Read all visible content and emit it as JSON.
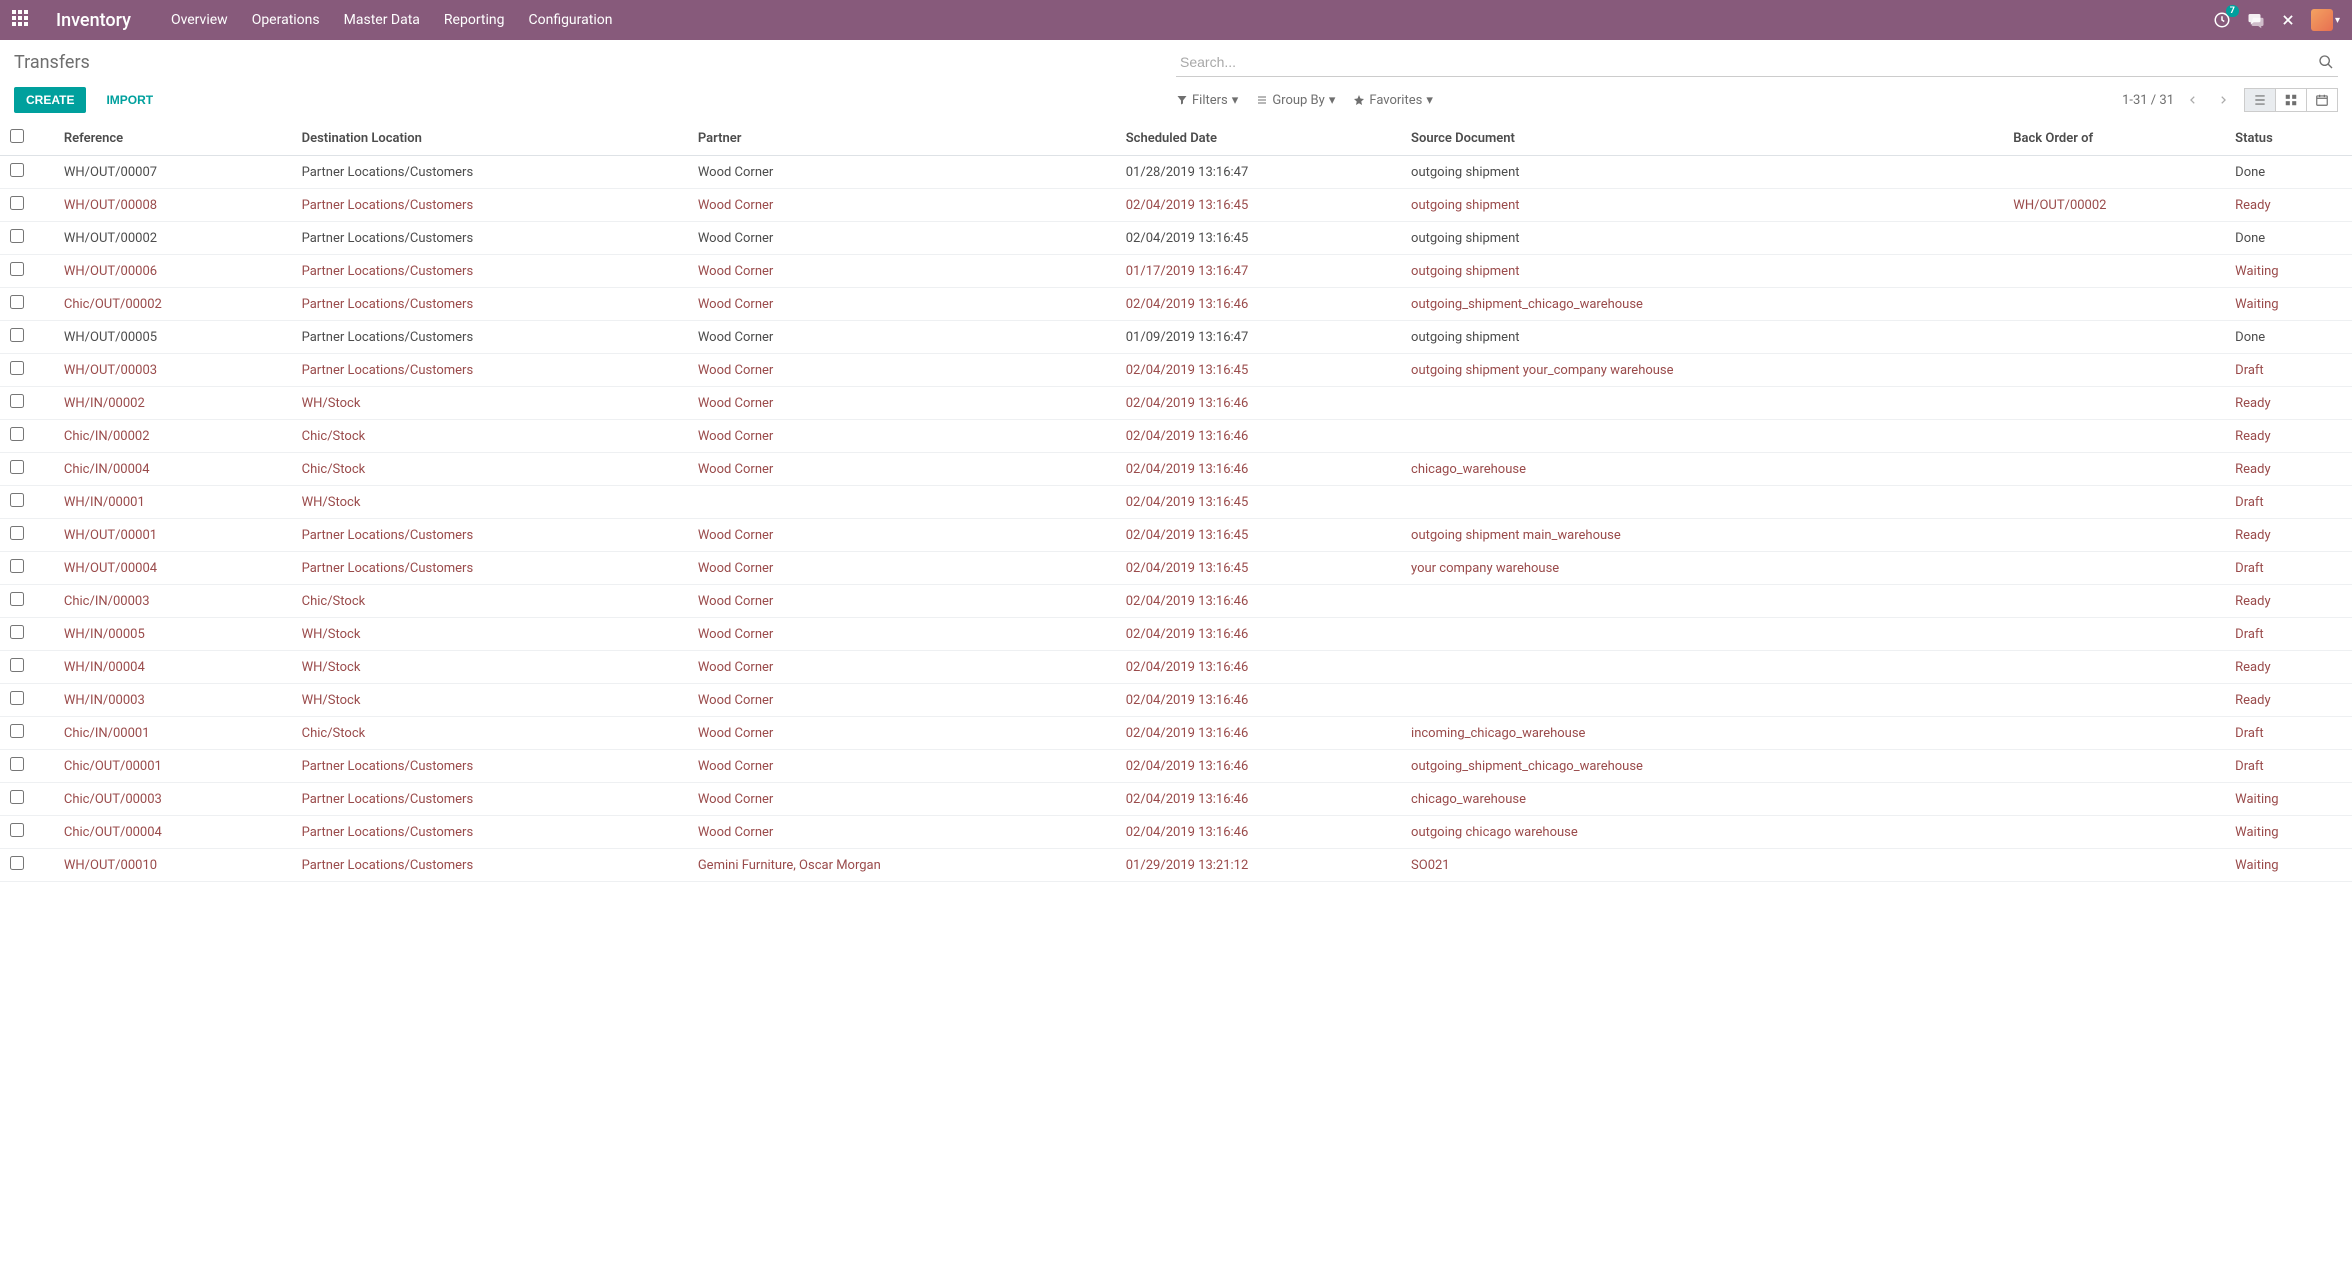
{
  "navbar": {
    "app_title": "Inventory",
    "menu": [
      "Overview",
      "Operations",
      "Master Data",
      "Reporting",
      "Configuration"
    ],
    "notif_count": "7"
  },
  "breadcrumb": "Transfers",
  "search": {
    "placeholder": "Search..."
  },
  "buttons": {
    "create": "CREATE",
    "import": "IMPORT"
  },
  "search_opts": {
    "filters": "Filters",
    "groupby": "Group By",
    "favorites": "Favorites"
  },
  "pager": {
    "range": "1-31 / 31"
  },
  "columns": {
    "reference": "Reference",
    "destination": "Destination Location",
    "partner": "Partner",
    "scheduled": "Scheduled Date",
    "source": "Source Document",
    "backorder": "Back Order of",
    "status": "Status"
  },
  "rows": [
    {
      "ref": "WH/OUT/00007",
      "dest": "Partner Locations/Customers",
      "partner": "Wood Corner",
      "date": "01/28/2019 13:16:47",
      "src": "outgoing shipment",
      "back": "",
      "status": "Done",
      "hl": false
    },
    {
      "ref": "WH/OUT/00008",
      "dest": "Partner Locations/Customers",
      "partner": "Wood Corner",
      "date": "02/04/2019 13:16:45",
      "src": "outgoing shipment",
      "back": "WH/OUT/00002",
      "status": "Ready",
      "hl": true
    },
    {
      "ref": "WH/OUT/00002",
      "dest": "Partner Locations/Customers",
      "partner": "Wood Corner",
      "date": "02/04/2019 13:16:45",
      "src": "outgoing shipment",
      "back": "",
      "status": "Done",
      "hl": false
    },
    {
      "ref": "WH/OUT/00006",
      "dest": "Partner Locations/Customers",
      "partner": "Wood Corner",
      "date": "01/17/2019 13:16:47",
      "src": "outgoing shipment",
      "back": "",
      "status": "Waiting",
      "hl": true
    },
    {
      "ref": "Chic/OUT/00002",
      "dest": "Partner Locations/Customers",
      "partner": "Wood Corner",
      "date": "02/04/2019 13:16:46",
      "src": "outgoing_shipment_chicago_warehouse",
      "back": "",
      "status": "Waiting",
      "hl": true
    },
    {
      "ref": "WH/OUT/00005",
      "dest": "Partner Locations/Customers",
      "partner": "Wood Corner",
      "date": "01/09/2019 13:16:47",
      "src": "outgoing shipment",
      "back": "",
      "status": "Done",
      "hl": false
    },
    {
      "ref": "WH/OUT/00003",
      "dest": "Partner Locations/Customers",
      "partner": "Wood Corner",
      "date": "02/04/2019 13:16:45",
      "src": "outgoing shipment your_company warehouse",
      "back": "",
      "status": "Draft",
      "hl": true
    },
    {
      "ref": "WH/IN/00002",
      "dest": "WH/Stock",
      "partner": "Wood Corner",
      "date": "02/04/2019 13:16:46",
      "src": "",
      "back": "",
      "status": "Ready",
      "hl": true
    },
    {
      "ref": "Chic/IN/00002",
      "dest": "Chic/Stock",
      "partner": "Wood Corner",
      "date": "02/04/2019 13:16:46",
      "src": "",
      "back": "",
      "status": "Ready",
      "hl": true
    },
    {
      "ref": "Chic/IN/00004",
      "dest": "Chic/Stock",
      "partner": "Wood Corner",
      "date": "02/04/2019 13:16:46",
      "src": "chicago_warehouse",
      "back": "",
      "status": "Ready",
      "hl": true
    },
    {
      "ref": "WH/IN/00001",
      "dest": "WH/Stock",
      "partner": "",
      "date": "02/04/2019 13:16:45",
      "src": "",
      "back": "",
      "status": "Draft",
      "hl": true
    },
    {
      "ref": "WH/OUT/00001",
      "dest": "Partner Locations/Customers",
      "partner": "Wood Corner",
      "date": "02/04/2019 13:16:45",
      "src": "outgoing shipment main_warehouse",
      "back": "",
      "status": "Ready",
      "hl": true
    },
    {
      "ref": "WH/OUT/00004",
      "dest": "Partner Locations/Customers",
      "partner": "Wood Corner",
      "date": "02/04/2019 13:16:45",
      "src": "your company warehouse",
      "back": "",
      "status": "Draft",
      "hl": true
    },
    {
      "ref": "Chic/IN/00003",
      "dest": "Chic/Stock",
      "partner": "Wood Corner",
      "date": "02/04/2019 13:16:46",
      "src": "",
      "back": "",
      "status": "Ready",
      "hl": true
    },
    {
      "ref": "WH/IN/00005",
      "dest": "WH/Stock",
      "partner": "Wood Corner",
      "date": "02/04/2019 13:16:46",
      "src": "",
      "back": "",
      "status": "Draft",
      "hl": true
    },
    {
      "ref": "WH/IN/00004",
      "dest": "WH/Stock",
      "partner": "Wood Corner",
      "date": "02/04/2019 13:16:46",
      "src": "",
      "back": "",
      "status": "Ready",
      "hl": true
    },
    {
      "ref": "WH/IN/00003",
      "dest": "WH/Stock",
      "partner": "Wood Corner",
      "date": "02/04/2019 13:16:46",
      "src": "",
      "back": "",
      "status": "Ready",
      "hl": true
    },
    {
      "ref": "Chic/IN/00001",
      "dest": "Chic/Stock",
      "partner": "Wood Corner",
      "date": "02/04/2019 13:16:46",
      "src": "incoming_chicago_warehouse",
      "back": "",
      "status": "Draft",
      "hl": true
    },
    {
      "ref": "Chic/OUT/00001",
      "dest": "Partner Locations/Customers",
      "partner": "Wood Corner",
      "date": "02/04/2019 13:16:46",
      "src": "outgoing_shipment_chicago_warehouse",
      "back": "",
      "status": "Draft",
      "hl": true
    },
    {
      "ref": "Chic/OUT/00003",
      "dest": "Partner Locations/Customers",
      "partner": "Wood Corner",
      "date": "02/04/2019 13:16:46",
      "src": "chicago_warehouse",
      "back": "",
      "status": "Waiting",
      "hl": true
    },
    {
      "ref": "Chic/OUT/00004",
      "dest": "Partner Locations/Customers",
      "partner": "Wood Corner",
      "date": "02/04/2019 13:16:46",
      "src": "outgoing chicago warehouse",
      "back": "",
      "status": "Waiting",
      "hl": true
    },
    {
      "ref": "WH/OUT/00010",
      "dest": "Partner Locations/Customers",
      "partner": "Gemini Furniture, Oscar Morgan",
      "date": "01/29/2019 13:21:12",
      "src": "SO021",
      "back": "",
      "status": "Waiting",
      "hl": true
    }
  ]
}
